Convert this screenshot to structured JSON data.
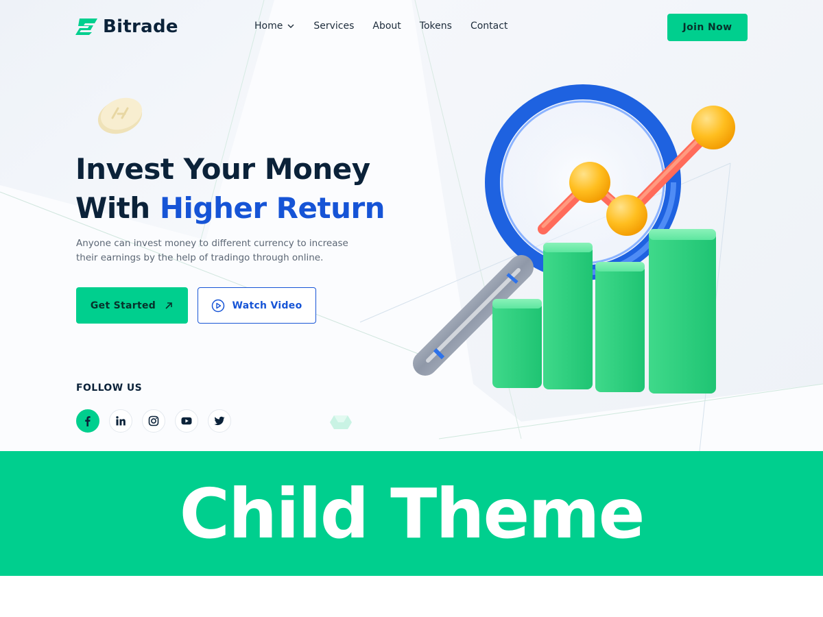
{
  "brand": {
    "name": "Bitrade"
  },
  "nav": {
    "items": [
      {
        "label": "Home"
      },
      {
        "label": "Services"
      },
      {
        "label": "About"
      },
      {
        "label": "Tokens"
      },
      {
        "label": "Contact"
      }
    ],
    "cta_label": "Join Now"
  },
  "hero": {
    "title_line1": "Invest Your Money",
    "title_line2_prefix": "With",
    "title_line2_accent": "Higher Return",
    "description": "Anyone can invest money to different currency to increase their earnings by the help of tradingo through online.",
    "primary_button": "Get Started",
    "secondary_button": "Watch Video"
  },
  "follow": {
    "label": "FOLLOW US",
    "networks": [
      "facebook-icon",
      "linkedin-icon",
      "instagram-icon",
      "youtube-icon",
      "twitter-icon"
    ]
  },
  "banner": {
    "text": "Child Theme"
  },
  "colors": {
    "accent_green": "#00cf8e",
    "accent_blue": "#1654d6",
    "heading": "#0b2239",
    "body_text": "#5b6674"
  }
}
